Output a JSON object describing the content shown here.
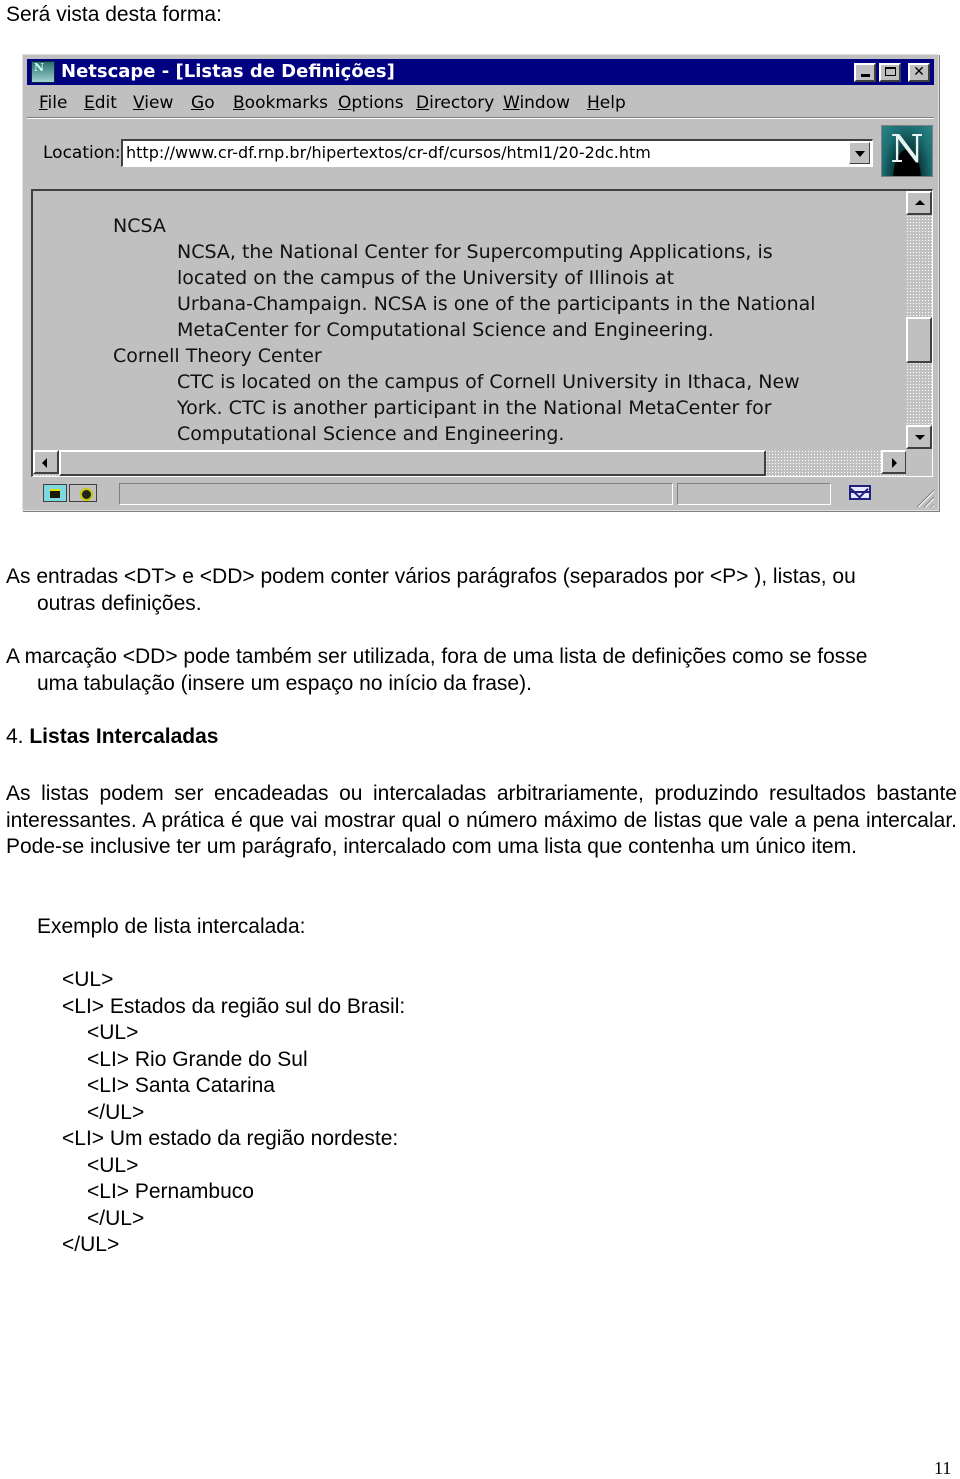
{
  "intro": "Será vista desta forma:",
  "browser": {
    "title": "Netscape - [Listas de Definições]",
    "title_icon_text": "N",
    "menu": [
      {
        "label": "File",
        "mnemonic": "F",
        "rest": "ile"
      },
      {
        "label": "Edit",
        "mnemonic": "E",
        "rest": "dit"
      },
      {
        "label": "View",
        "mnemonic": "V",
        "rest": "iew"
      },
      {
        "label": "Go",
        "mnemonic": "G",
        "rest": "o"
      },
      {
        "label": "Bookmarks",
        "mnemonic": "B",
        "rest": "ookmarks"
      },
      {
        "label": "Options",
        "mnemonic": "O",
        "rest": "ptions"
      },
      {
        "label": "Directory",
        "mnemonic": "D",
        "rest": "irectory"
      },
      {
        "label": "Window",
        "mnemonic": "W",
        "rest": "indow"
      },
      {
        "label": "Help",
        "mnemonic": "H",
        "rest": "elp"
      }
    ],
    "location_label": "Location:",
    "location_url": "http://www.cr-df.rnp.br/hipertextos/cr-df/cursos/html1/20-2dc.htm",
    "throbber_letter": "N",
    "definitions": [
      {
        "term": "NCSA",
        "description_lines": [
          "NCSA, the National Center for Supercomputing Applications, is",
          "located on the campus of the University of Illinois at",
          "Urbana-Champaign. NCSA is one of the participants in the National",
          "MetaCenter for Computational Science and Engineering."
        ]
      },
      {
        "term": "Cornell Theory Center",
        "description_lines": [
          "CTC is located on the campus of Cornell University in Ithaca, New",
          "York. CTC is another participant in the National MetaCenter for",
          "Computational Science and Engineering."
        ]
      }
    ],
    "vertical_scroll_position": 0.62,
    "horizontal_scroll_visible_fraction": 0.86,
    "icons": {
      "security": "security-key-icon",
      "mail": "mail-envelope-icon"
    }
  },
  "paragraphs": {
    "p1_line1": "As entradas <DT> e <DD> podem conter vários parágrafos (separados por <P> ), listas, ou",
    "p1_line2": "outras definições.",
    "p2_line1": "A marcação <DD> pode também ser utilizada, fora de uma lista de definições como se fosse",
    "p2_line2": "uma tabulação (insere um espaço no início da frase).",
    "section_number": "4.",
    "section_title": "Listas Intercaladas",
    "p3": "As listas podem ser encadeadas ou intercaladas arbitrariamente, produzindo resultados bastante interessantes. A prática é que vai mostrar qual o número máximo de listas que vale a pena intercalar. Pode-se inclusive ter um parágrafo, intercalado com uma lista que contenha um único item.",
    "example_label": "Exemplo de lista intercalada:"
  },
  "code_example": [
    {
      "text": "<UL>",
      "indent": 0
    },
    {
      "text": "<LI> Estados da região sul do Brasil:",
      "indent": 0
    },
    {
      "text": "<UL>",
      "indent": 1
    },
    {
      "text": "<LI> Rio Grande do Sul",
      "indent": 1
    },
    {
      "text": "<LI> Santa Catarina",
      "indent": 1
    },
    {
      "text": "</UL>",
      "indent": 1
    },
    {
      "text": "<LI> Um estado da região nordeste:",
      "indent": 0
    },
    {
      "text": "<UL>",
      "indent": 1
    },
    {
      "text": "<LI> Pernambuco",
      "indent": 1
    },
    {
      "text": "</UL>",
      "indent": 1
    },
    {
      "text": "</UL>",
      "indent": 0
    }
  ],
  "page_number": "11"
}
